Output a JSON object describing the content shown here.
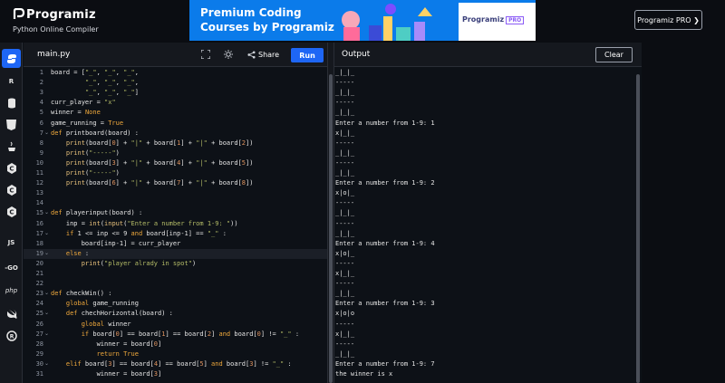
{
  "brand": {
    "name": "Programiz",
    "subtitle": "Python Online Compiler"
  },
  "ad": {
    "headline_1": "Premium Coding",
    "headline_2": "Courses by Programiz",
    "box_brand": "Programiz",
    "box_badge": "PRO"
  },
  "header_button": "Programiz PRO ❯",
  "sidebar": {
    "items": [
      {
        "icon": "python-icon",
        "label": ""
      },
      {
        "icon": "r-icon",
        "label": "R"
      },
      {
        "icon": "sql-icon",
        "label": ""
      },
      {
        "icon": "html-icon",
        "label": "5"
      },
      {
        "icon": "java-icon",
        "label": ""
      },
      {
        "icon": "c-icon",
        "label": "C"
      },
      {
        "icon": "cpp-icon",
        "label": "C"
      },
      {
        "icon": "csharp-icon",
        "label": "C"
      },
      {
        "icon": "js-icon",
        "label": "JS"
      },
      {
        "icon": "go-icon",
        "label": "-GO"
      },
      {
        "icon": "php-icon",
        "label": "php"
      },
      {
        "icon": "swift-icon",
        "label": ""
      },
      {
        "icon": "rust-icon",
        "label": "R"
      }
    ]
  },
  "editor": {
    "file_name": "main.py",
    "share_label": "Share",
    "run_label": "Run",
    "lines": [
      "board = [\"_\", \"_\", \"_\",",
      "         \"_\", \"_\", \"_\",",
      "         \"_\", \"_\", \"_\"]",
      "curr_player = \"x\"",
      "winner = None",
      "game_running = True",
      "def printboard(board) :",
      "    print(board[0] + \"|\" + board[1] + \"|\" + board[2])",
      "    print(\"-----\")",
      "    print(board[3] + \"|\" + board[4] + \"|\" + board[5])",
      "    print(\"-----\")",
      "    print(board[6] + \"|\" + board[7] + \"|\" + board[8])",
      "",
      "",
      "def playerinput(board) :",
      "    inp = int(input(\"Enter a number from 1-9: \"))",
      "    if 1 <= inp <= 9 and board[inp-1] == \"_\" :",
      "        board[inp-1] = curr_player",
      "    else :",
      "        print(\"player alrady in spot\")",
      "",
      "",
      "def checkWin() :",
      "    global game_running",
      "    def chechHorizontal(board) :",
      "        global winner",
      "        if board[0] == board[1] == board[2] and board[0] != \"_\" :",
      "            winner = board[0]",
      "            return True",
      "    elif board[3] == board[4] == board[5] and board[3] != \"_\" :",
      "            winner = board[3]"
    ],
    "line_numbers": [
      "1",
      "2",
      "3",
      "4",
      "5",
      "6",
      "7",
      "8",
      "9",
      "10",
      "11",
      "12",
      "13",
      "14",
      "15",
      "16",
      "17",
      "18",
      "19",
      "20",
      "21",
      "22",
      "23",
      "24",
      "25",
      "26",
      "27",
      "28",
      "29",
      "30",
      "31"
    ]
  },
  "output": {
    "title": "Output",
    "clear_label": "Clear",
    "lines": [
      "_|_|_",
      "-----",
      "_|_|_",
      "-----",
      "_|_|_",
      "Enter a number from 1-9: 1",
      "x|_|_",
      "-----",
      "_|_|_",
      "-----",
      "_|_|_",
      "Enter a number from 1-9: 2",
      "x|o|_",
      "-----",
      "_|_|_",
      "-----",
      "_|_|_",
      "Enter a number from 1-9: 4",
      "x|o|_",
      "-----",
      "x|_|_",
      "-----",
      "_|_|_",
      "Enter a number from 1-9: 3",
      "x|o|o",
      "-----",
      "x|_|_",
      "-----",
      "_|_|_",
      "Enter a number from 1-9: 7",
      "the winner is x"
    ]
  },
  "colors": {
    "accent": "#1e66f5",
    "background": "#0d1117",
    "panel": "#15181e"
  }
}
